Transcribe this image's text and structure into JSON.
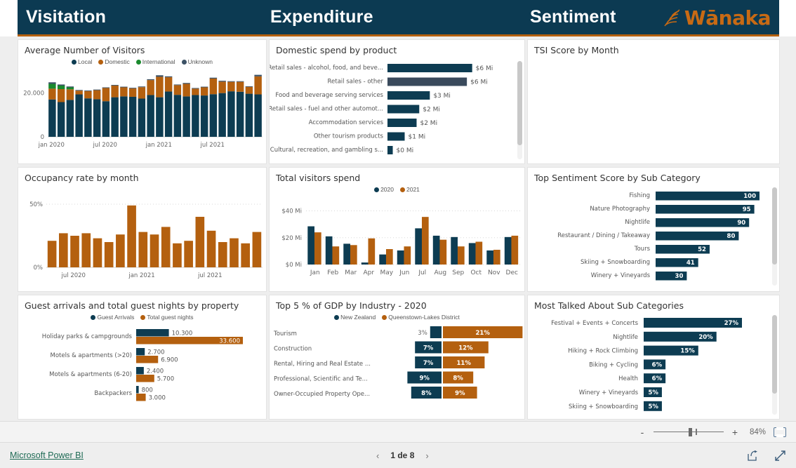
{
  "header": {
    "titles": [
      "Visitation",
      "Expenditure",
      "Sentiment"
    ],
    "logo_text": "Wānaka",
    "bg_color": "#0c3a52",
    "accent_color": "#b4600f"
  },
  "colors": {
    "teal": "#0d3c52",
    "orange": "#b4600f",
    "green": "#1a8a2e",
    "gray": "#3c5266",
    "highlight": "#3a4a5c"
  },
  "cards": {
    "visitors": {
      "title": "Average Number of Visitors"
    },
    "domestic_spend": {
      "title": "Domestic spend by product"
    },
    "tsi": {
      "title": "TSI Score by Month"
    },
    "occupancy": {
      "title": "Occupancy rate by month"
    },
    "total_spend": {
      "title": "Total visitors spend"
    },
    "sentiment": {
      "title": "Top Sentiment Score by Sub Category"
    },
    "guests": {
      "title": "Guest arrivals and total guest nights by property"
    },
    "gdp": {
      "title": "Top 5 % of GDP by Industry - 2020"
    },
    "talked": {
      "title": "Most Talked About Sub Categories"
    }
  },
  "chart_data": [
    {
      "id": "visitors",
      "type": "bar",
      "title": "Average Number of Visitors",
      "stacked": true,
      "legend": [
        {
          "name": "Local",
          "color": "#0d3c52"
        },
        {
          "name": "Domestic",
          "color": "#b4600f"
        },
        {
          "name": "International",
          "color": "#1a8a2e"
        },
        {
          "name": "Unknown",
          "color": "#3c5266"
        }
      ],
      "legend_position": "top",
      "xlabel": "",
      "ylabel": "",
      "ylim": [
        0,
        30000
      ],
      "yticks": [
        "0",
        "20.000"
      ],
      "xticks": [
        "jan 2020",
        "jul 2020",
        "jan 2021",
        "jul 2021"
      ],
      "categories": [
        "jan 2020",
        "feb 2020",
        "mar 2020",
        "apr 2020",
        "may 2020",
        "jun 2020",
        "jul 2020",
        "ago 2020",
        "sep 2020",
        "oct 2020",
        "nov 2020",
        "dic 2020",
        "jan 2021",
        "feb 2021",
        "mar 2021",
        "apr 2021",
        "may 2021",
        "jun 2021",
        "jul 2021",
        "ago 2021",
        "sep 2021",
        "oct 2021",
        "nov 2021",
        "dic 2021"
      ],
      "series": [
        {
          "name": "Local",
          "color": "#0d3c52",
          "values": [
            17000,
            15800,
            16800,
            19300,
            17500,
            17100,
            16200,
            18000,
            18400,
            18200,
            17400,
            19000,
            18000,
            20600,
            19100,
            18400,
            19000,
            18800,
            19400,
            19900,
            20700,
            20500,
            19600,
            19300
          ]
        },
        {
          "name": "Domestic",
          "color": "#b4600f",
          "values": [
            4900,
            5900,
            4800,
            1700,
            3300,
            4100,
            6000,
            5300,
            4100,
            3800,
            5200,
            6800,
            9300,
            6500,
            4400,
            5700,
            2900,
            3700,
            7100,
            5200,
            4300,
            4500,
            3100,
            8200
          ]
        },
        {
          "name": "International",
          "color": "#1a8a2e",
          "values": [
            2200,
            1600,
            900,
            0,
            0,
            0,
            0,
            0,
            0,
            0,
            0,
            0,
            0,
            0,
            0,
            0,
            0,
            0,
            0,
            0,
            0,
            0,
            0,
            0
          ]
        },
        {
          "name": "Unknown",
          "color": "#3c5266",
          "values": [
            700,
            500,
            400,
            300,
            300,
            300,
            300,
            300,
            300,
            300,
            300,
            400,
            700,
            400,
            300,
            400,
            300,
            300,
            400,
            400,
            300,
            300,
            300,
            700
          ]
        }
      ]
    },
    {
      "id": "domestic_spend",
      "type": "bar",
      "orientation": "horizontal",
      "title": "Domestic spend by product",
      "categories": [
        "Retail sales - alcohol, food, and beve...",
        "Retail sales - other",
        "Food and beverage serving services",
        "Retail sales - fuel and other automot...",
        "Accommodation services",
        "Other tourism products",
        "Cultural, recreation, and gambling s..."
      ],
      "values": [
        6.4,
        6.0,
        3.2,
        2.4,
        2.2,
        1.3,
        0.4
      ],
      "labels": [
        "$6 Mi",
        "$6 Mi",
        "$3 Mi",
        "$2 Mi",
        "$2 Mi",
        "$1 Mi",
        "$0 Mi"
      ],
      "highlight_index": 1,
      "xlim": [
        0,
        7
      ],
      "bar_color": "#0d3c52",
      "highlight_color": "#3a4a5c"
    },
    {
      "id": "tsi",
      "type": "line",
      "title": "TSI Score by Month",
      "categories": [],
      "values": [],
      "note": "empty visual"
    },
    {
      "id": "occupancy",
      "type": "bar",
      "title": "Occupancy rate by month",
      "ylim": [
        0,
        50
      ],
      "yticks": [
        "0%",
        "50%"
      ],
      "xticks": [
        "jul 2020",
        "jan 2021",
        "jul 2021"
      ],
      "bar_color": "#b4600f",
      "categories": [
        "may 2020",
        "jun 2020",
        "jul 2020",
        "ago 2020",
        "sep 2020",
        "oct 2020",
        "nov 2020",
        "dic 2020",
        "jan 2021",
        "feb 2021",
        "mar 2021",
        "apr 2021",
        "may 2021",
        "jun 2021",
        "jul 2021",
        "ago 2021",
        "sep 2021",
        "oct 2021",
        "nov 2021"
      ],
      "values": [
        21,
        27,
        25,
        27,
        23,
        20,
        26,
        49,
        28,
        26,
        32,
        19,
        21,
        40,
        29,
        20,
        23,
        19,
        28
      ]
    },
    {
      "id": "total_spend",
      "type": "bar",
      "title": "Total visitors spend",
      "legend": [
        {
          "name": "2020",
          "color": "#0d3c52"
        },
        {
          "name": "2021",
          "color": "#b4600f"
        }
      ],
      "legend_position": "top",
      "yticks": [
        "$0 Mi",
        "$20 Mi",
        "$40 Mi"
      ],
      "ylim": [
        0,
        45
      ],
      "categories": [
        "Jan",
        "Feb",
        "Mar",
        "Apr",
        "May",
        "Jun",
        "Jul",
        "Aug",
        "Sep",
        "Oct",
        "Nov",
        "Dec"
      ],
      "series": [
        {
          "name": "2020",
          "color": "#0d3c52",
          "values": [
            28.5,
            21.0,
            15.5,
            1.5,
            7.5,
            10.5,
            27.0,
            21.5,
            20.5,
            16.0,
            10.5,
            20.5
          ]
        },
        {
          "name": "2021",
          "color": "#b4600f",
          "values": [
            24.0,
            13.5,
            14.5,
            19.5,
            11.5,
            13.5,
            35.5,
            18.5,
            13.5,
            17.0,
            11.0,
            21.5
          ]
        }
      ]
    },
    {
      "id": "sentiment",
      "type": "bar",
      "orientation": "horizontal",
      "title": "Top Sentiment Score by Sub Category",
      "categories": [
        "Fishing",
        "Nature Photography",
        "Nightlife",
        "Restaurant / Dining / Takeaway",
        "Tours",
        "Skiing + Snowboarding",
        "Winery + Vineyards"
      ],
      "values": [
        100,
        95,
        90,
        80,
        52,
        41,
        30
      ],
      "labels": [
        "100",
        "95",
        "90",
        "80",
        "52",
        "41",
        "30"
      ],
      "xlim": [
        0,
        100
      ],
      "bar_color": "#0d3c52"
    },
    {
      "id": "guests",
      "type": "bar",
      "orientation": "horizontal",
      "title": "Guest arrivals and total guest nights by property",
      "legend": [
        {
          "name": "Guest Arrivals",
          "color": "#0d3c52"
        },
        {
          "name": "Total guest nights",
          "color": "#b4600f"
        }
      ],
      "legend_position": "top",
      "categories": [
        "Holiday parks & campgrounds",
        "Motels & apartments (>20)",
        "Motels & apartments (6-20)",
        "Backpackers"
      ],
      "xlim": [
        0,
        33600
      ],
      "series": [
        {
          "name": "Guest Arrivals",
          "color": "#0d3c52",
          "values": [
            10300,
            2700,
            2400,
            800
          ],
          "labels": [
            "10.300",
            "2.700",
            "2.400",
            "800"
          ]
        },
        {
          "name": "Total guest nights",
          "color": "#b4600f",
          "values": [
            33600,
            6900,
            5700,
            3000
          ],
          "labels": [
            "33.600",
            "6.900",
            "5.700",
            "3.000"
          ]
        }
      ]
    },
    {
      "id": "gdp",
      "type": "bar",
      "orientation": "horizontal-diverging",
      "title": "Top 5 % of GDP by Industry - 2020",
      "legend": [
        {
          "name": "New Zealand",
          "color": "#0d3c52"
        },
        {
          "name": "Queenstown-Lakes District",
          "color": "#b4600f"
        }
      ],
      "legend_position": "top",
      "categories": [
        "Tourism",
        "Construction",
        "Rental, Hiring and Real Estate ...",
        "Professional, Scientific and Te...",
        "Owner-Occupied Property Ope..."
      ],
      "series": [
        {
          "name": "New Zealand",
          "color": "#0d3c52",
          "values": [
            3,
            7,
            7,
            9,
            8
          ],
          "labels": [
            "3%",
            "7%",
            "7%",
            "9%",
            "8%"
          ]
        },
        {
          "name": "Queenstown-Lakes District",
          "color": "#b4600f",
          "values": [
            21,
            12,
            11,
            8,
            9
          ],
          "labels": [
            "21%",
            "12%",
            "11%",
            "8%",
            "9%"
          ]
        }
      ]
    },
    {
      "id": "talked",
      "type": "bar",
      "orientation": "horizontal",
      "title": "Most Talked About Sub Categories",
      "categories": [
        "Festival + Events + Concerts",
        "Nightlife",
        "Hiking + Rock Climbing",
        "Biking + Cycling",
        "Health",
        "Winery + Vineyards",
        "Skiing + Snowboarding"
      ],
      "values": [
        27,
        20,
        15,
        6,
        6,
        5,
        5
      ],
      "labels": [
        "27%",
        "20%",
        "15%",
        "6%",
        "6%",
        "5%",
        "5%"
      ],
      "xlim": [
        0,
        27
      ],
      "bar_color": "#0d3c52"
    }
  ],
  "zoombar": {
    "minus": "-",
    "plus": "+",
    "zoom_level": "84%",
    "fit_label": "fit-to-page"
  },
  "statusbar": {
    "powerbi_link": "Microsoft Power BI",
    "prev": "‹",
    "next": "›",
    "page_text": "1 de 8"
  }
}
